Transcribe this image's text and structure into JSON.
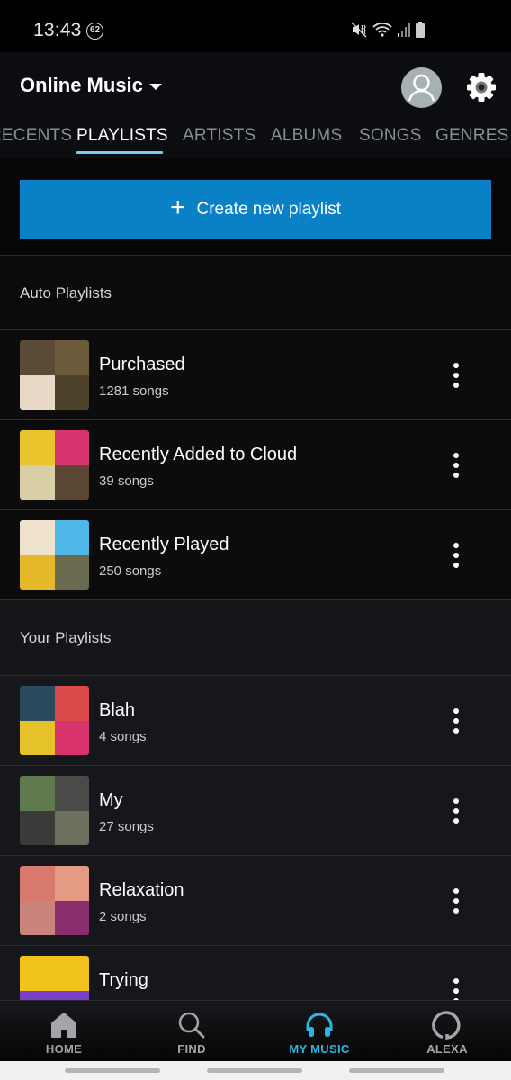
{
  "status_bar": {
    "time": "13:43",
    "notification_badge": "62",
    "icons": [
      "mute-vibrate-icon",
      "wifi-icon",
      "signal-icon",
      "battery-icon"
    ]
  },
  "header": {
    "title": "Online Music",
    "dropdown_icon": "caret-down-icon",
    "avatar_icon": "user-avatar-icon",
    "settings_icon": "gear-icon"
  },
  "tabs": [
    {
      "label": "RECENTS",
      "active": false
    },
    {
      "label": "PLAYLISTS",
      "active": true
    },
    {
      "label": "ARTISTS",
      "active": false
    },
    {
      "label": "ALBUMS",
      "active": false
    },
    {
      "label": "SONGS",
      "active": false
    },
    {
      "label": "GENRES",
      "active": false
    }
  ],
  "create_button": {
    "label": "Create new playlist",
    "icon": "plus-icon"
  },
  "sections": {
    "auto": {
      "title": "Auto Playlists",
      "items": [
        {
          "name": "Purchased",
          "count": "1281 songs",
          "art": [
            "#5a4a36",
            "#6b5b3a",
            "#e7d9c5",
            "#4d432a"
          ]
        },
        {
          "name": "Recently Added to Cloud",
          "count": "39 songs",
          "art": [
            "#e9c42c",
            "#d6336f",
            "#d9cfa6",
            "#5a4632"
          ]
        },
        {
          "name": "Recently Played",
          "count": "250 songs",
          "art": [
            "#efe2cc",
            "#4fb8e8",
            "#e5b92a",
            "#6a6a4e"
          ]
        }
      ]
    },
    "yours": {
      "title": "Your Playlists",
      "items": [
        {
          "name": "Blah",
          "count": "4 songs",
          "art": [
            "#2a4a5e",
            "#d94a4a",
            "#e5c22a",
            "#d9336e"
          ]
        },
        {
          "name": "My",
          "count": "27 songs",
          "art": [
            "#5f7a4e",
            "#4a4a48",
            "#3a3a38",
            "#6b705e"
          ]
        },
        {
          "name": "Relaxation",
          "count": "2 songs",
          "art": [
            "#d97a6e",
            "#e59a84",
            "#c9857c",
            "#8a2e6e"
          ]
        },
        {
          "name": "Trying",
          "count": "",
          "art": [
            "#f2c21c",
            "#f2c21c",
            "#7a3ec9",
            "#7a3ec9"
          ]
        }
      ]
    }
  },
  "bottom_nav": [
    {
      "label": "HOME",
      "icon": "home-icon",
      "active": false
    },
    {
      "label": "FIND",
      "icon": "search-icon",
      "active": false
    },
    {
      "label": "MY MUSIC",
      "icon": "headphones-icon",
      "active": true
    },
    {
      "label": "ALEXA",
      "icon": "alexa-icon",
      "active": false
    }
  ],
  "colors": {
    "accent": "#0a81c6",
    "active_tab_underline": "#7ec8f0",
    "active_nav": "#28b8e6"
  }
}
